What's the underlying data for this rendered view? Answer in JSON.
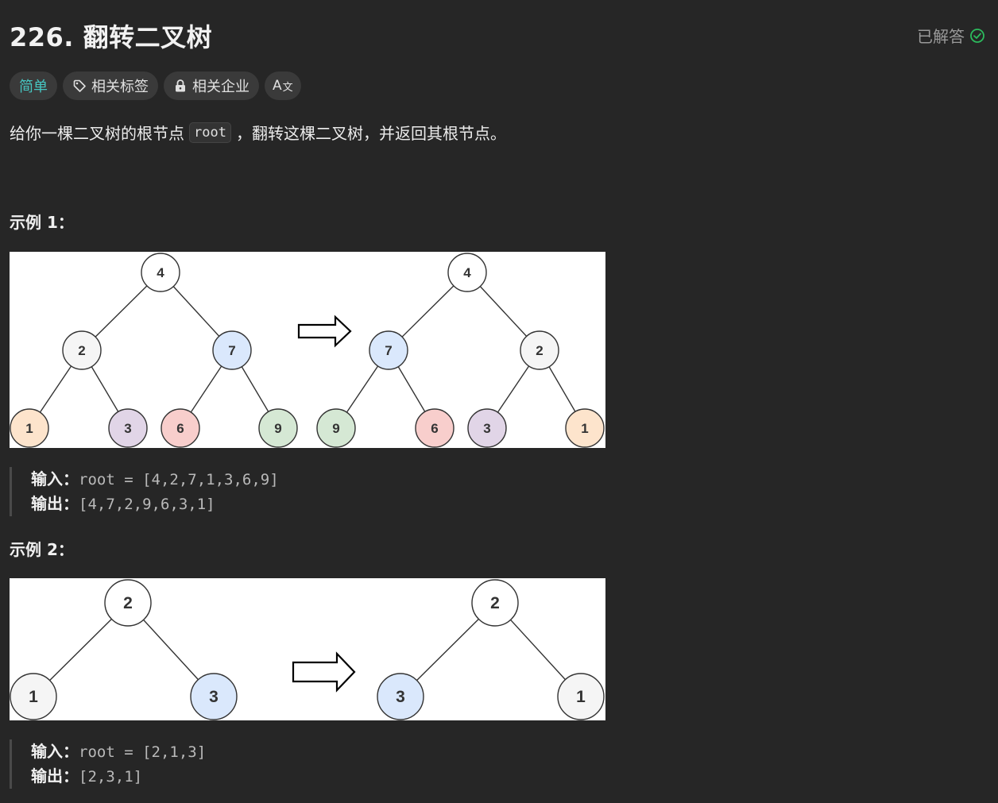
{
  "problem": {
    "title": "226. 翻转二叉树",
    "status_label": "已解答",
    "tags": {
      "difficulty": "简单",
      "related_tags": "相关标签",
      "related_companies": "相关企业",
      "translate": "A"
    },
    "description": {
      "part1": "给你一棵二叉树的根节点",
      "code": "root",
      "part2": "，翻转这棵二叉树，并返回其根节点。"
    }
  },
  "examples": [
    {
      "title": "示例 1：",
      "input_label": "输入：",
      "input_value": "root = [4,2,7,1,3,6,9]",
      "output_label": "输出：",
      "output_value": "[4,7,2,9,6,3,1]",
      "tree_before": [
        "4",
        "2",
        "7",
        "1",
        "3",
        "6",
        "9"
      ],
      "tree_after": [
        "4",
        "7",
        "2",
        "9",
        "6",
        "3",
        "1"
      ]
    },
    {
      "title": "示例 2：",
      "input_label": "输入：",
      "input_value": "root = [2,1,3]",
      "output_label": "输出：",
      "output_value": "[2,3,1]",
      "tree_before": [
        "2",
        "1",
        "3"
      ],
      "tree_after": [
        "2",
        "3",
        "1"
      ]
    }
  ],
  "colors": {
    "easy": "#46c6c2",
    "solved_check": "#2cbb5d",
    "node_orange": "#fde4cc",
    "node_purple": "#e1d5e7",
    "node_red": "#f8cecc",
    "node_green": "#d5e8d4",
    "node_blue": "#dae8fc",
    "node_gray": "#f5f5f5",
    "node_white": "#ffffff"
  }
}
